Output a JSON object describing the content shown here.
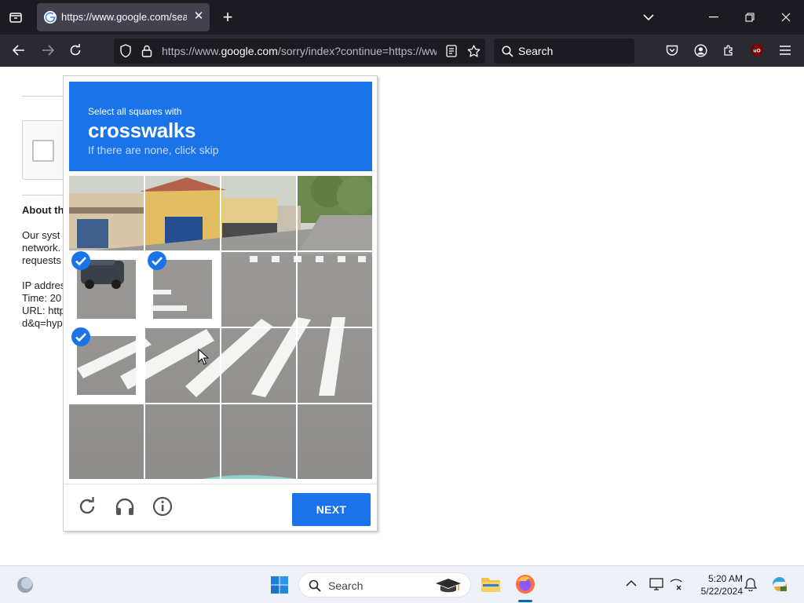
{
  "browser": {
    "tab_title": "https://www.google.com/search",
    "url_prefix": "https://www.",
    "url_domain": "google.com",
    "url_rest": "/sorry/index?continue=https://www",
    "search_placeholder": "Search"
  },
  "background_page": {
    "about_heading": "About th",
    "lines": [
      "Our syst",
      "network.",
      "requests",
      "IP addres",
      "Time: 20",
      "URL: http",
      "d&q=hyp"
    ]
  },
  "captcha": {
    "instruction_small": "Select all squares with",
    "target_word": "crosswalks",
    "hint": "If there are none, click skip",
    "grid_rows": 4,
    "grid_cols": 4,
    "selected_tiles": [
      [
        1,
        0
      ],
      [
        1,
        1
      ],
      [
        2,
        0
      ]
    ],
    "next_label": "NEXT",
    "footer_icons": [
      "reload-icon",
      "audio-challenge-icon",
      "info-icon"
    ]
  },
  "taskbar": {
    "search_placeholder": "Search",
    "time": "5:20 AM",
    "date": "5/22/2024"
  },
  "colors": {
    "captcha_blue": "#1a73e8",
    "browser_dark": "#1c1b22",
    "taskbar_bg": "#eef1f8"
  }
}
